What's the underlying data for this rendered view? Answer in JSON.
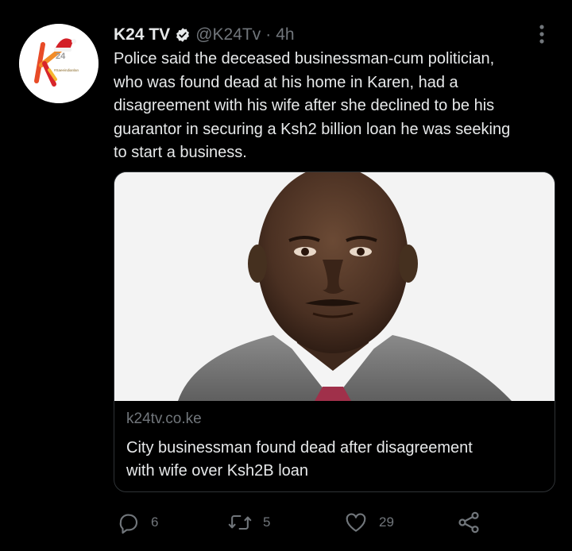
{
  "tweet": {
    "display_name": "K24 TV",
    "handle": "@K24Tv",
    "separator": "·",
    "time": "4h",
    "text_lines": [
      "Police said the deceased businessman-cum politician,",
      "who was found dead at his home in Karen, had a",
      "disagreement with his wife after she declined to be his",
      "guarantor in securing a Ksh2 billion loan he was seeking",
      "to start a business."
    ],
    "avatar_icon": "k24-logo-icon",
    "verified_icon": "verified-badge-icon",
    "more_icon": "more-vertical-icon"
  },
  "card": {
    "domain": "k24tv.co.ke",
    "title_lines": [
      "City businessman found dead after disagreement",
      "with wife over Ksh2B loan"
    ]
  },
  "actions": {
    "reply_count": "6",
    "retweet_count": "5",
    "like_count": "29",
    "reply_icon": "reply-icon",
    "retweet_icon": "retweet-icon",
    "like_icon": "heart-icon",
    "share_icon": "share-icon"
  },
  "colors": {
    "background": "#000000",
    "text": "#e7e9ea",
    "muted": "#71767b",
    "border": "#2f3336"
  }
}
